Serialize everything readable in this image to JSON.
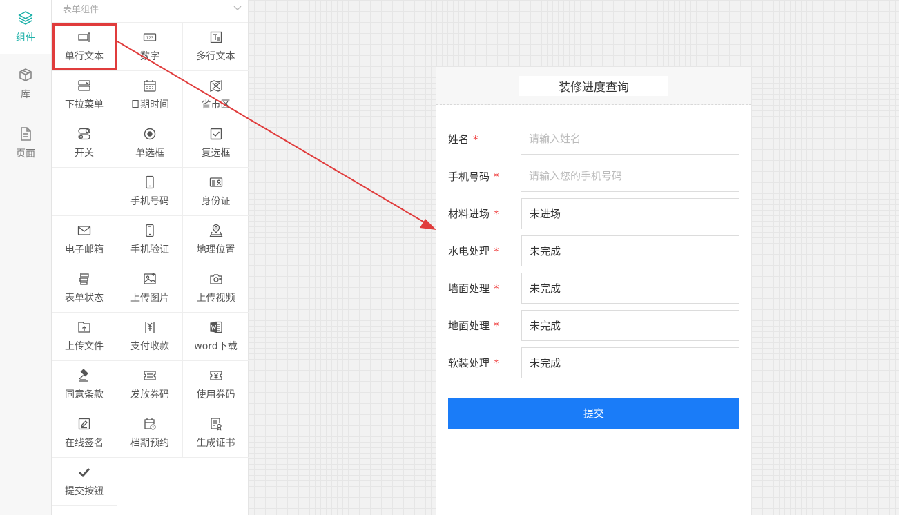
{
  "rail": {
    "items": [
      {
        "label": "组件",
        "icon": "layers-icon",
        "active": true
      },
      {
        "label": "库",
        "icon": "package-icon",
        "active": false
      },
      {
        "label": "页面",
        "icon": "document-icon",
        "active": false
      }
    ]
  },
  "panel": {
    "title": "表单组件",
    "components": [
      {
        "label": "单行文本",
        "icon": "single-line-text-icon"
      },
      {
        "label": "数字",
        "icon": "number-icon"
      },
      {
        "label": "多行文本",
        "icon": "multi-line-text-icon"
      },
      {
        "label": "下拉菜单",
        "icon": "dropdown-icon"
      },
      {
        "label": "日期时间",
        "icon": "calendar-icon"
      },
      {
        "label": "省市区",
        "icon": "region-map-icon"
      },
      {
        "label": "开关",
        "icon": "switch-icon"
      },
      {
        "label": "单选框",
        "icon": "radio-icon"
      },
      {
        "label": "复选框",
        "icon": "checkbox-icon"
      },
      {
        "label": "",
        "icon": ""
      },
      {
        "label": "手机号码",
        "icon": "phone-icon"
      },
      {
        "label": "身份证",
        "icon": "id-card-icon"
      },
      {
        "label": "电子邮箱",
        "icon": "mail-icon"
      },
      {
        "label": "手机验证",
        "icon": "phone-verify-icon"
      },
      {
        "label": "地理位置",
        "icon": "location-icon"
      },
      {
        "label": "表单状态",
        "icon": "form-status-icon"
      },
      {
        "label": "上传图片",
        "icon": "upload-image-icon"
      },
      {
        "label": "上传视频",
        "icon": "upload-video-icon"
      },
      {
        "label": "上传文件",
        "icon": "upload-file-icon"
      },
      {
        "label": "支付收款",
        "icon": "payment-icon"
      },
      {
        "label": "word下载",
        "icon": "word-icon"
      },
      {
        "label": "同意条款",
        "icon": "gavel-icon"
      },
      {
        "label": "发放券码",
        "icon": "coupon-issue-icon"
      },
      {
        "label": "使用券码",
        "icon": "coupon-use-icon"
      },
      {
        "label": "在线签名",
        "icon": "signature-icon"
      },
      {
        "label": "档期预约",
        "icon": "schedule-icon"
      },
      {
        "label": "生成证书",
        "icon": "certificate-icon"
      },
      {
        "label": "提交按钮",
        "icon": "checkmark-icon"
      }
    ]
  },
  "form": {
    "title": "装修进度查询",
    "fields": [
      {
        "label": "姓名",
        "required": "*",
        "placeholder": "请输入姓名",
        "value": ""
      },
      {
        "label": "手机号码",
        "required": "*",
        "placeholder": "请输入您的手机号码",
        "value": ""
      },
      {
        "label": "材料进场",
        "required": "*",
        "placeholder": "",
        "value": "未进场"
      },
      {
        "label": "水电处理",
        "required": "*",
        "placeholder": "",
        "value": "未完成"
      },
      {
        "label": "墙面处理",
        "required": "*",
        "placeholder": "",
        "value": "未完成"
      },
      {
        "label": "地面处理",
        "required": "*",
        "placeholder": "",
        "value": "未完成"
      },
      {
        "label": "软装处理",
        "required": "*",
        "placeholder": "",
        "value": "未完成"
      }
    ],
    "submit_label": "提交"
  },
  "colors": {
    "accent": "#20b2aa",
    "submit": "#1a7cf8",
    "annotation": "#e03c3c",
    "required": "#e33333"
  }
}
